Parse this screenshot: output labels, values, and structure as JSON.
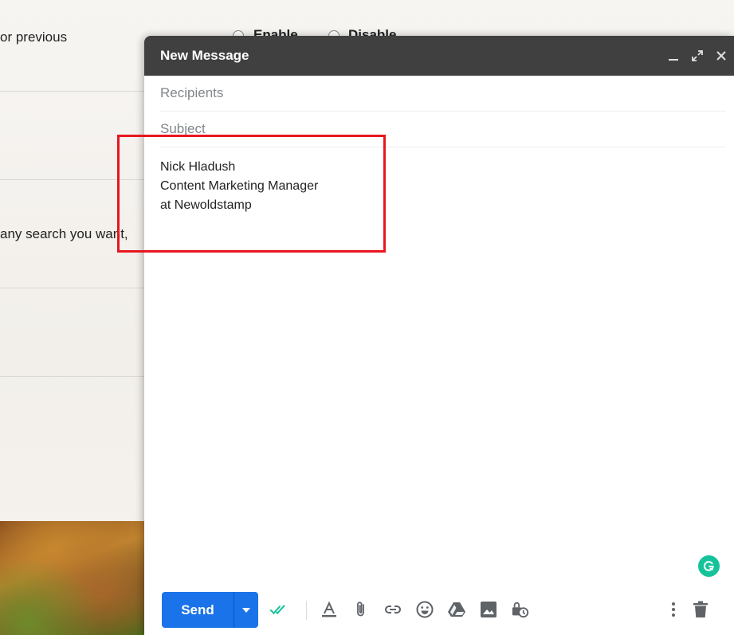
{
  "background": {
    "line1_text": "or previous",
    "radio_enable_label": "Enable",
    "radio_disable_label": "Disable",
    "line2_text": "any search you want,"
  },
  "compose": {
    "title": "New Message",
    "recipients_placeholder": "Recipients",
    "subject_placeholder": "Subject",
    "body_lines": [
      "Nick Hladush",
      "Content Marketing Manager",
      "at Newoldstamp"
    ],
    "send_label": "Send"
  },
  "icons": {
    "header": [
      "minimize-icon",
      "expand-icon",
      "close-icon"
    ],
    "toolbar": [
      "double-check-icon",
      "format-text-icon",
      "attach-icon",
      "link-icon",
      "emoji-icon",
      "drive-icon",
      "photo-icon",
      "confidential-mode-icon",
      "more-options-icon",
      "trash-icon"
    ]
  },
  "colors": {
    "header_bg": "#404040",
    "send_button": "#1a73e8",
    "highlight_box": "#e8161f",
    "grammarly": "#15c39a",
    "check_icon": "#15c39a"
  }
}
